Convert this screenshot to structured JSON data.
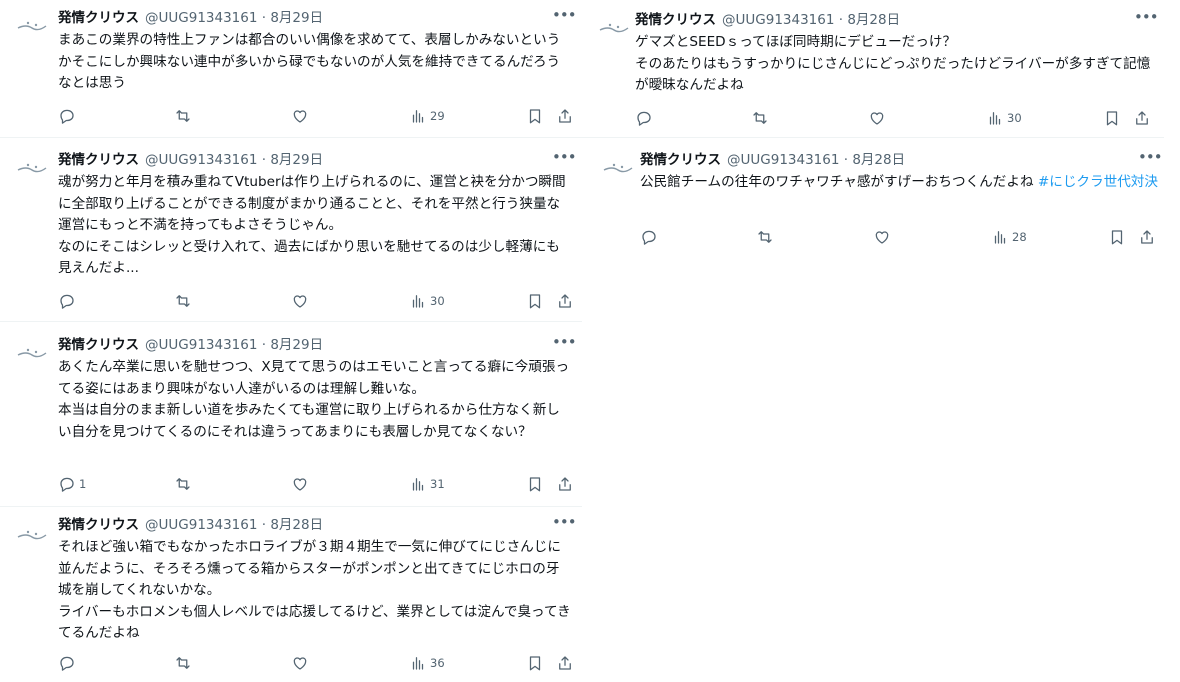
{
  "tweets": [
    {
      "name": "発情クリウス",
      "handle": "@UUG91343161",
      "date": "8月29日",
      "paragraphs": [
        "まあこの業界の特性上ファンは都合のいい偶像を求めてて、表層しかみないというかそこにしか興味ない連中が多いから碌でもないのが人気を維持できてるんだろうなとは思う"
      ],
      "reply_count": "",
      "view_count": "29"
    },
    {
      "name": "発情クリウス",
      "handle": "@UUG91343161",
      "date": "8月29日",
      "paragraphs": [
        "魂が努力と年月を積み重ねてVtuberは作り上げられるのに、運営と袂を分かつ瞬間に全部取り上げることができる制度がまかり通ることと、それを平然と行う狭量な運営にもっと不満を持ってもよさそうじゃん。",
        "なのにそこはシレッと受け入れて、過去にばかり思いを馳せてるのは少し軽薄にも見えんだよ..."
      ],
      "reply_count": "",
      "view_count": "30"
    },
    {
      "name": "発情クリウス",
      "handle": "@UUG91343161",
      "date": "8月29日",
      "paragraphs": [
        "あくたん卒業に思いを馳せつつ、X見てて思うのはエモいこと言ってる癖に今頑張ってる姿にはあまり興味がない人達がいるのは理解し難いな。",
        "本当は自分のまま新しい道を歩みたくても運営に取り上げられるから仕方なく新しい自分を見つけてくるのにそれは違うってあまりにも表層しか見てなくない？"
      ],
      "reply_count": "1",
      "view_count": "31"
    },
    {
      "name": "発情クリウス",
      "handle": "@UUG91343161",
      "date": "8月28日",
      "paragraphs": [
        "それほど強い箱でもなかったホロライブが３期４期生で一気に伸びてにじさんじに並んだように、そろそろ燻ってる箱からスターがポンポンと出てきてにじホロの牙城を崩してくれないかな。",
        "ライバーもホロメンも個人レベルでは応援してるけど、業界としては淀んで臭ってきてるんだよね"
      ],
      "reply_count": "",
      "view_count": "36"
    },
    {
      "name": "発情クリウス",
      "handle": "@UUG91343161",
      "date": "8月28日",
      "paragraphs": [
        "ゲマズとSEEDｓってほぼ同時期にデビューだっけ？",
        "そのあたりはもうすっかりにじさんじにどっぷりだったけどライバーが多すぎて記憶が曖昧なんだよね"
      ],
      "reply_count": "",
      "view_count": "30"
    },
    {
      "name": "発情クリウス",
      "handle": "@UUG91343161",
      "date": "8月28日",
      "paragraphs": [
        "公民館チームの往年のワチャワチャ感がすげーおちつくんだよね "
      ],
      "hashtag": "#にじクラ世代対決",
      "reply_count": "",
      "view_count": "28"
    }
  ],
  "separator": "·",
  "icons": [
    "reply-icon",
    "retweet-icon",
    "like-icon",
    "views-icon",
    "bookmark-icon",
    "share-icon",
    "more-icon",
    "avatar"
  ],
  "colors": {
    "text": "#0f1419",
    "secondary": "#536471",
    "hashtag": "#1d9bf0",
    "divider": "#eff3f4"
  }
}
